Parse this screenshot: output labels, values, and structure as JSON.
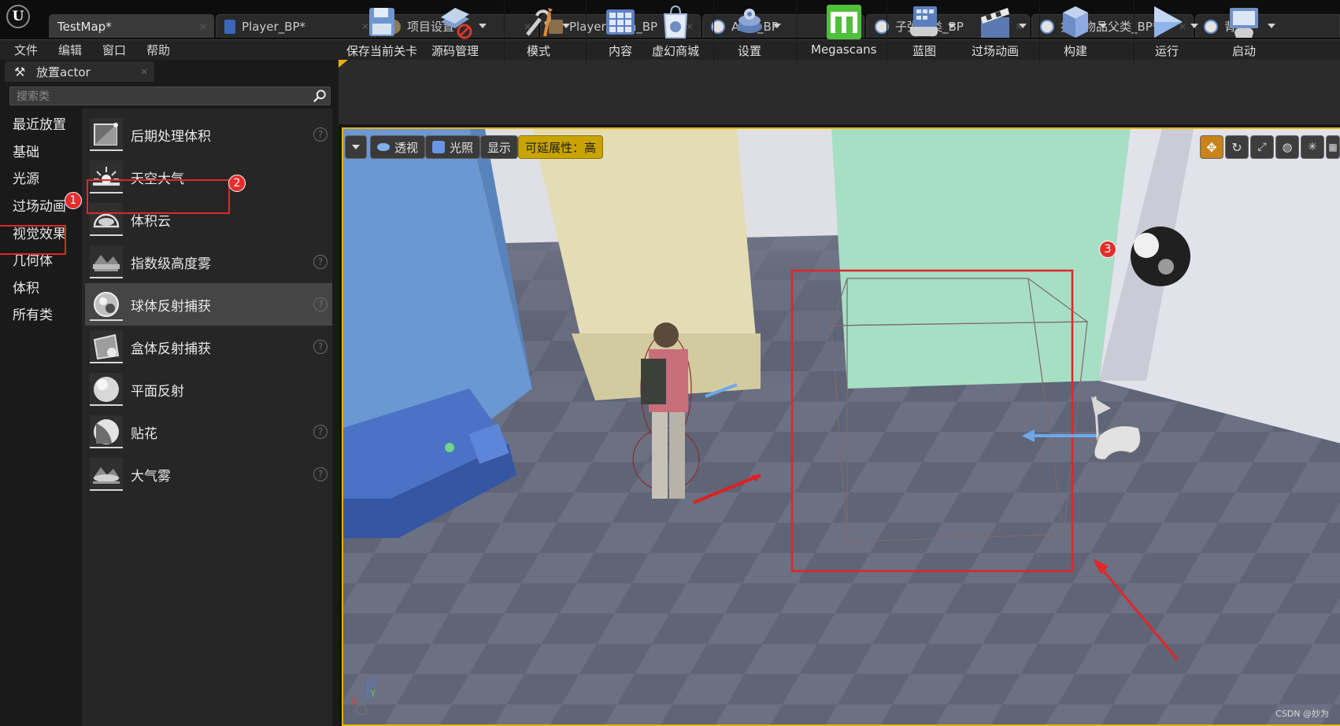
{
  "titlebar": {
    "tabs": [
      {
        "label": "TestMap",
        "dirty": "*",
        "icon": "map-icon"
      },
      {
        "label": "Player_BP",
        "dirty": "*",
        "icon": "blueprint-icon"
      },
      {
        "label": "项目设置",
        "dirty": "",
        "icon": "settings-icon"
      },
      {
        "label": "PlayerAnim_BP",
        "dirty": "",
        "icon": "anim-blueprint-icon"
      },
      {
        "label": "AKM_BP",
        "dirty": "",
        "icon": "blueprint-sphere-icon"
      },
      {
        "label": "子弹父类_BP",
        "dirty": "",
        "icon": "blueprint-sphere-icon"
      },
      {
        "label": "拾取物品父类_BP",
        "dirty": "*",
        "icon": "blueprint-sphere-icon"
      },
      {
        "label": "背",
        "dirty": "",
        "icon": "blueprint-sphere-icon"
      }
    ]
  },
  "menubar": {
    "items": [
      "文件",
      "编辑",
      "窗口",
      "帮助"
    ]
  },
  "place_panel": {
    "tab_label": "放置actor",
    "search_placeholder": "搜索类",
    "categories": [
      "最近放置",
      "基础",
      "光源",
      "过场动画",
      "视觉效果",
      "几何体",
      "体积",
      "所有类"
    ],
    "selected_category": "视觉效果",
    "items": [
      {
        "label": "后期处理体积",
        "icon": "post-process-volume-icon",
        "help": true
      },
      {
        "label": "天空大气",
        "icon": "sky-atmosphere-icon",
        "help": false
      },
      {
        "label": "体积云",
        "icon": "volumetric-cloud-icon",
        "help": false
      },
      {
        "label": "指数级高度雾",
        "icon": "height-fog-icon",
        "help": true
      },
      {
        "label": "球体反射捕获",
        "icon": "sphere-reflection-icon",
        "help": true
      },
      {
        "label": "盒体反射捕获",
        "icon": "box-reflection-icon",
        "help": true
      },
      {
        "label": "平面反射",
        "icon": "planar-reflection-icon",
        "help": false
      },
      {
        "label": "贴花",
        "icon": "decal-icon",
        "help": true
      },
      {
        "label": "大气雾",
        "icon": "atmospheric-fog-icon",
        "help": true
      }
    ]
  },
  "annotations": {
    "badge1": "1",
    "badge2": "2",
    "badge3": "3"
  },
  "toolbar": {
    "buttons": [
      {
        "label": "保存当前关卡",
        "icon": "save-icon"
      },
      {
        "label": "源码管理",
        "icon": "source-control-icon"
      },
      {
        "label": "模式",
        "icon": "modes-icon"
      },
      {
        "label": "内容",
        "icon": "content-icon"
      },
      {
        "label": "虚幻商城",
        "icon": "marketplace-icon"
      },
      {
        "label": "设置",
        "icon": "settings-icon"
      },
      {
        "label": "Megascans",
        "icon": "megascans-icon"
      },
      {
        "label": "蓝图",
        "icon": "blueprints-icon"
      },
      {
        "label": "过场动画",
        "icon": "cinematics-icon"
      },
      {
        "label": "构建",
        "icon": "build-icon"
      },
      {
        "label": "运行",
        "icon": "play-icon"
      },
      {
        "label": "启动",
        "icon": "launch-icon"
      }
    ]
  },
  "viewport": {
    "view_mode": "透视",
    "lighting": "光照",
    "show": "显示",
    "scalability": "可延展性：高",
    "watermark": "CSDN @妙为",
    "axis": {
      "z": "Z",
      "y": "Y",
      "x": "X"
    }
  },
  "colors": {
    "accent_yellow": "#e6b10e",
    "annotation_red": "#e0262a",
    "badge_red": "#e52d2d"
  }
}
